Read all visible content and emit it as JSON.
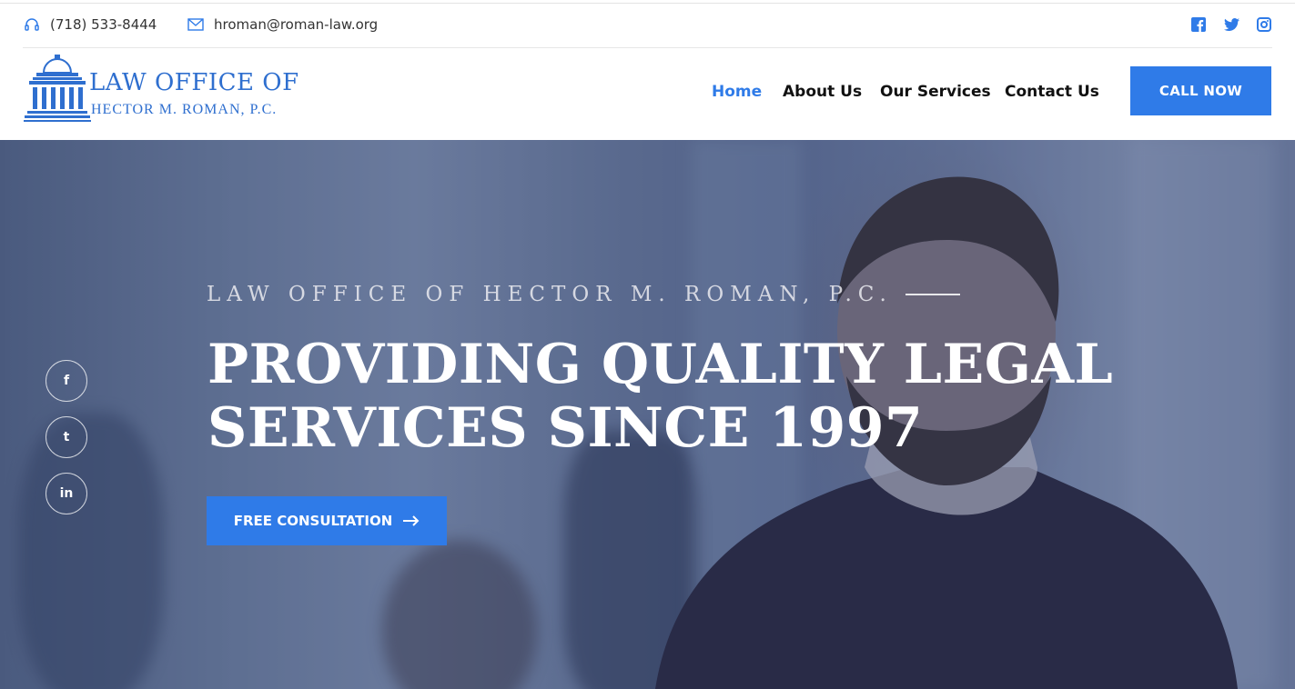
{
  "topbar": {
    "phone": "(718) 533-8444",
    "email": "hroman@roman-law.org",
    "social_icons": [
      "facebook-icon",
      "twitter-icon",
      "instagram-icon"
    ]
  },
  "logo": {
    "line1": "LAW OFFICE OF",
    "line2": "HECTOR M. ROMAN, P.C."
  },
  "nav": {
    "items": [
      {
        "label": "Home",
        "active": true
      },
      {
        "label": "About Us",
        "active": false
      },
      {
        "label": "Our Services",
        "active": false
      },
      {
        "label": "Contact Us",
        "active": false
      }
    ],
    "cta_label": "CALL NOW"
  },
  "hero": {
    "kicker": "LAW OFFICE OF HECTOR M. ROMAN, P.C.",
    "headline_line1": "PROVIDING QUALITY LEGAL",
    "headline_line2": "SERVICES SINCE 1997",
    "button_label": "FREE CONSULTATION",
    "side_social": [
      {
        "icon": "facebook-icon",
        "glyph": "f"
      },
      {
        "icon": "twitter-icon",
        "glyph": "t"
      },
      {
        "icon": "linkedin-icon",
        "glyph": "in"
      }
    ]
  },
  "colors": {
    "accent": "#2f7be8",
    "logo_blue": "#2f6fcf"
  }
}
